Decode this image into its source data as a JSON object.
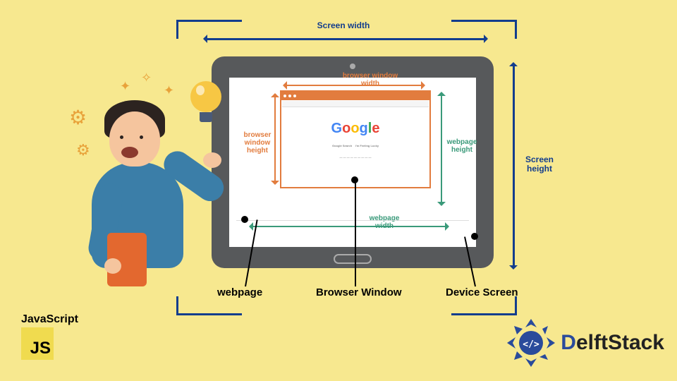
{
  "labels": {
    "screen_width": "Screen width",
    "screen_height": "Screen height",
    "browser_width": "browser window width",
    "browser_height": "browser window height",
    "webpage_width": "webpage width",
    "webpage_height": "webpage height"
  },
  "pointers": {
    "webpage": "webpage",
    "browser_window": "Browser Window",
    "device_screen": "Device Screen"
  },
  "browser": {
    "logo_text": "Google",
    "link1": "Google Search",
    "link2": "I'm Feeling Lucky"
  },
  "badges": {
    "js_title": "JavaScript",
    "js_short": "JS",
    "brand": "DelftStack"
  }
}
